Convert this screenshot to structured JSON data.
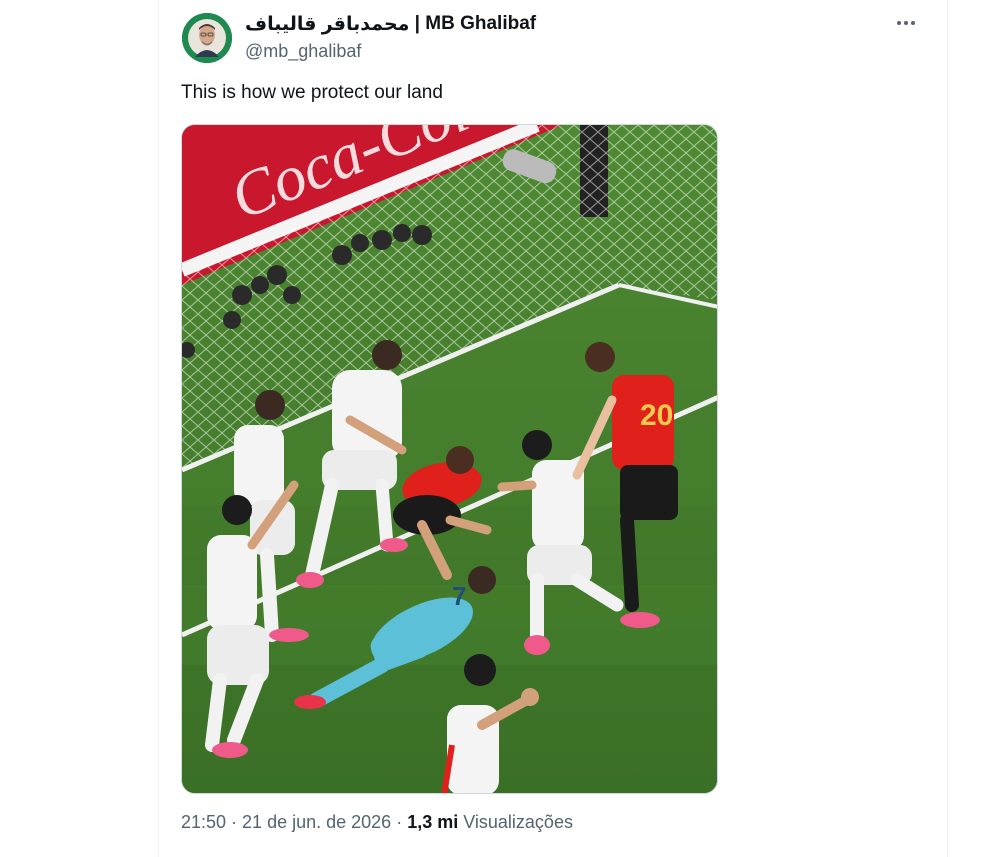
{
  "author": {
    "display_name_ar": "محمدباقر قالیباف",
    "separator": " | ",
    "display_name_en": "MB Ghalibaf",
    "handle": "@mb_ghalibaf"
  },
  "tweet": {
    "text": "This is how we protect our land"
  },
  "media": {
    "banner_text": "Coca-Cola",
    "shirt_number_forward": "20",
    "shirt_number_keeper": "7"
  },
  "meta": {
    "time": "21:50",
    "dot1": " · ",
    "date": "21 de jun. de 2026",
    "dot2": " · ",
    "views_count": "1,3 mi",
    "views_label": " Visualizações"
  },
  "colors": {
    "text_primary": "#0f1419",
    "text_secondary": "#536471",
    "pitch": "#3f7a2a",
    "iran_kit": "#f2f2f2",
    "belgium_kit": "#e0201b",
    "keeper_kit": "#5bc0d8"
  },
  "icons": {
    "more": "more-horizontal-icon"
  }
}
